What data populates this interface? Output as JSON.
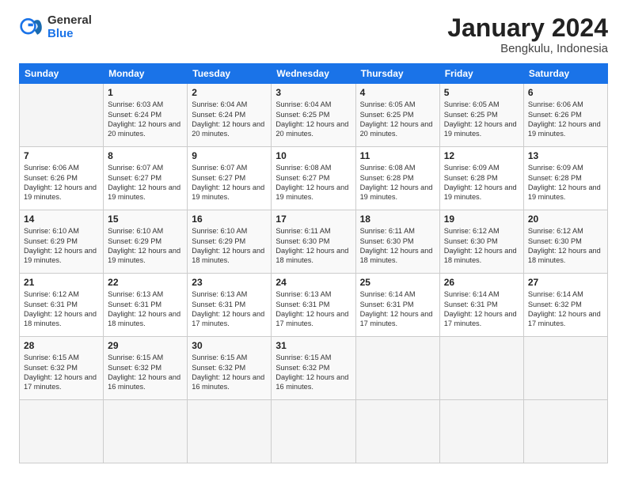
{
  "logo": {
    "general": "General",
    "blue": "Blue"
  },
  "header": {
    "month": "January 2024",
    "location": "Bengkulu, Indonesia"
  },
  "weekdays": [
    "Sunday",
    "Monday",
    "Tuesday",
    "Wednesday",
    "Thursday",
    "Friday",
    "Saturday"
  ],
  "days": [
    {
      "date": null,
      "info": null
    },
    {
      "date": "1",
      "sunrise": "6:03 AM",
      "sunset": "6:24 PM",
      "daylight": "12 hours and 20 minutes."
    },
    {
      "date": "2",
      "sunrise": "6:04 AM",
      "sunset": "6:24 PM",
      "daylight": "12 hours and 20 minutes."
    },
    {
      "date": "3",
      "sunrise": "6:04 AM",
      "sunset": "6:25 PM",
      "daylight": "12 hours and 20 minutes."
    },
    {
      "date": "4",
      "sunrise": "6:05 AM",
      "sunset": "6:25 PM",
      "daylight": "12 hours and 20 minutes."
    },
    {
      "date": "5",
      "sunrise": "6:05 AM",
      "sunset": "6:25 PM",
      "daylight": "12 hours and 19 minutes."
    },
    {
      "date": "6",
      "sunrise": "6:06 AM",
      "sunset": "6:26 PM",
      "daylight": "12 hours and 19 minutes."
    },
    {
      "date": "7",
      "sunrise": "6:06 AM",
      "sunset": "6:26 PM",
      "daylight": "12 hours and 19 minutes."
    },
    {
      "date": "8",
      "sunrise": "6:07 AM",
      "sunset": "6:27 PM",
      "daylight": "12 hours and 19 minutes."
    },
    {
      "date": "9",
      "sunrise": "6:07 AM",
      "sunset": "6:27 PM",
      "daylight": "12 hours and 19 minutes."
    },
    {
      "date": "10",
      "sunrise": "6:08 AM",
      "sunset": "6:27 PM",
      "daylight": "12 hours and 19 minutes."
    },
    {
      "date": "11",
      "sunrise": "6:08 AM",
      "sunset": "6:28 PM",
      "daylight": "12 hours and 19 minutes."
    },
    {
      "date": "12",
      "sunrise": "6:09 AM",
      "sunset": "6:28 PM",
      "daylight": "12 hours and 19 minutes."
    },
    {
      "date": "13",
      "sunrise": "6:09 AM",
      "sunset": "6:28 PM",
      "daylight": "12 hours and 19 minutes."
    },
    {
      "date": "14",
      "sunrise": "6:10 AM",
      "sunset": "6:29 PM",
      "daylight": "12 hours and 19 minutes."
    },
    {
      "date": "15",
      "sunrise": "6:10 AM",
      "sunset": "6:29 PM",
      "daylight": "12 hours and 19 minutes."
    },
    {
      "date": "16",
      "sunrise": "6:10 AM",
      "sunset": "6:29 PM",
      "daylight": "12 hours and 18 minutes."
    },
    {
      "date": "17",
      "sunrise": "6:11 AM",
      "sunset": "6:30 PM",
      "daylight": "12 hours and 18 minutes."
    },
    {
      "date": "18",
      "sunrise": "6:11 AM",
      "sunset": "6:30 PM",
      "daylight": "12 hours and 18 minutes."
    },
    {
      "date": "19",
      "sunrise": "6:12 AM",
      "sunset": "6:30 PM",
      "daylight": "12 hours and 18 minutes."
    },
    {
      "date": "20",
      "sunrise": "6:12 AM",
      "sunset": "6:30 PM",
      "daylight": "12 hours and 18 minutes."
    },
    {
      "date": "21",
      "sunrise": "6:12 AM",
      "sunset": "6:31 PM",
      "daylight": "12 hours and 18 minutes."
    },
    {
      "date": "22",
      "sunrise": "6:13 AM",
      "sunset": "6:31 PM",
      "daylight": "12 hours and 18 minutes."
    },
    {
      "date": "23",
      "sunrise": "6:13 AM",
      "sunset": "6:31 PM",
      "daylight": "12 hours and 17 minutes."
    },
    {
      "date": "24",
      "sunrise": "6:13 AM",
      "sunset": "6:31 PM",
      "daylight": "12 hours and 17 minutes."
    },
    {
      "date": "25",
      "sunrise": "6:14 AM",
      "sunset": "6:31 PM",
      "daylight": "12 hours and 17 minutes."
    },
    {
      "date": "26",
      "sunrise": "6:14 AM",
      "sunset": "6:31 PM",
      "daylight": "12 hours and 17 minutes."
    },
    {
      "date": "27",
      "sunrise": "6:14 AM",
      "sunset": "6:32 PM",
      "daylight": "12 hours and 17 minutes."
    },
    {
      "date": "28",
      "sunrise": "6:15 AM",
      "sunset": "6:32 PM",
      "daylight": "12 hours and 17 minutes."
    },
    {
      "date": "29",
      "sunrise": "6:15 AM",
      "sunset": "6:32 PM",
      "daylight": "12 hours and 16 minutes."
    },
    {
      "date": "30",
      "sunrise": "6:15 AM",
      "sunset": "6:32 PM",
      "daylight": "12 hours and 16 minutes."
    },
    {
      "date": "31",
      "sunrise": "6:15 AM",
      "sunset": "6:32 PM",
      "daylight": "12 hours and 16 minutes."
    },
    {
      "date": null,
      "info": null
    },
    {
      "date": null,
      "info": null
    },
    {
      "date": null,
      "info": null
    },
    {
      "date": null,
      "info": null
    }
  ],
  "labels": {
    "sunrise": "Sunrise:",
    "sunset": "Sunset:",
    "daylight": "Daylight:"
  }
}
